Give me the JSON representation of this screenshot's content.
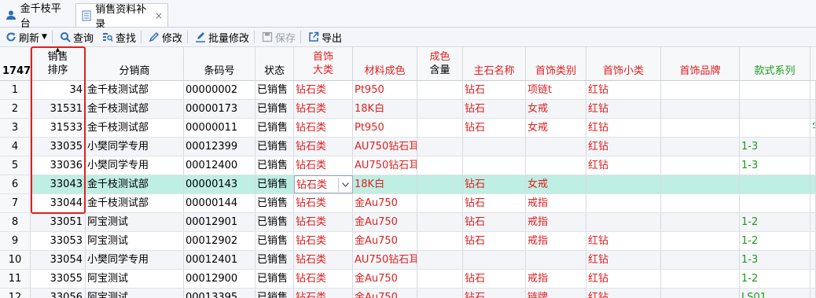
{
  "tabs": [
    {
      "label": "金千枝平台",
      "icon": "avatar-icon"
    },
    {
      "label": "销售资料补录",
      "icon": "document-icon",
      "close": "×"
    }
  ],
  "toolbar": {
    "refresh": "刷新",
    "query": "查询",
    "find": "查找",
    "edit": "修改",
    "batch_edit": "批量修改",
    "save": "保存",
    "export": "导出"
  },
  "grid": {
    "headers": {
      "rownum": "1747",
      "sort_line1": "销售",
      "sort_line2": "排序",
      "distributor": "分销商",
      "barcode": "条码号",
      "status": "状态",
      "cat_line1": "首饰",
      "cat_line2": "大类",
      "material": "材料成色",
      "purity_line1": "成色",
      "purity_line2": "含量",
      "stone": "主石名称",
      "jewelry_type": "首饰类别",
      "jewelry_sub": "首饰小类",
      "brand": "首饰品牌",
      "series": "款式系列"
    },
    "rows": [
      {
        "n": "1",
        "sort": "34",
        "dist": "金千枝测试部",
        "barcode": "00000002",
        "status": "已销售",
        "cat": "钻石类",
        "material": "Pt950",
        "purity": "",
        "stone": "钻石",
        "type": "项链t",
        "sub": "红钻",
        "brand": "",
        "series": "",
        "extra": ""
      },
      {
        "n": "2",
        "sort": "31531",
        "dist": "金千枝测试部",
        "barcode": "00000173",
        "status": "已销售",
        "cat": "钻石类",
        "material": "18K白",
        "purity": "",
        "stone": "钻石",
        "type": "女戒",
        "sub": "红钻",
        "brand": "",
        "series": "",
        "extra": ""
      },
      {
        "n": "3",
        "sort": "31533",
        "dist": "金千枝测试部",
        "barcode": "00000011",
        "status": "已销售",
        "cat": "钻石类",
        "material": "Pt950",
        "purity": "",
        "stone": "钻石",
        "type": "女戒",
        "sub": "红钻",
        "brand": "",
        "series": "",
        "extra": "字"
      },
      {
        "n": "4",
        "sort": "33035",
        "dist": "小樊同学专用",
        "barcode": "00012399",
        "status": "已销售",
        "cat": "钻石类",
        "material": "AU750钻石耳",
        "purity": "",
        "stone": "",
        "type": "",
        "sub": "红钻",
        "brand": "",
        "series": "1-3",
        "extra": ""
      },
      {
        "n": "5",
        "sort": "33036",
        "dist": "小樊同学专用",
        "barcode": "00012400",
        "status": "已销售",
        "cat": "钻石类",
        "material": "AU750钻石耳",
        "purity": "",
        "stone": "",
        "type": "",
        "sub": "红钻",
        "brand": "",
        "series": "1-3",
        "extra": ""
      },
      {
        "n": "6",
        "sort": "33043",
        "dist": "金千枝测试部",
        "barcode": "00000143",
        "status": "已销售",
        "cat": "钻石类",
        "material": "18K白",
        "purity": "",
        "stone": "钻石",
        "type": "女戒",
        "sub": "",
        "brand": "",
        "series": "",
        "extra": ""
      },
      {
        "n": "7",
        "sort": "33044",
        "dist": "金千枝测试部",
        "barcode": "00000144",
        "status": "已销售",
        "cat": "钻石类",
        "material": "金Au750",
        "purity": "",
        "stone": "钻石",
        "type": "戒指",
        "sub": "",
        "brand": "",
        "series": "",
        "extra": ""
      },
      {
        "n": "8",
        "sort": "33051",
        "dist": "阿宝测试",
        "barcode": "00012901",
        "status": "已销售",
        "cat": "钻石类",
        "material": "金Au750",
        "purity": "",
        "stone": "钻石",
        "type": "戒指",
        "sub": "",
        "brand": "",
        "series": "1-2",
        "extra": ""
      },
      {
        "n": "9",
        "sort": "33053",
        "dist": "阿宝测试",
        "barcode": "00012902",
        "status": "已销售",
        "cat": "钻石类",
        "material": "金Au750",
        "purity": "",
        "stone": "钻石",
        "type": "戒指",
        "sub": "红钻",
        "brand": "",
        "series": "1-2",
        "extra": ""
      },
      {
        "n": "10",
        "sort": "33054",
        "dist": "小樊同学专用",
        "barcode": "00012401",
        "status": "已销售",
        "cat": "钻石类",
        "material": "AU750钻石耳",
        "purity": "",
        "stone": "",
        "type": "",
        "sub": "红钻",
        "brand": "",
        "series": "1-3",
        "extra": ""
      },
      {
        "n": "11",
        "sort": "33055",
        "dist": "阿宝测试",
        "barcode": "00012900",
        "status": "已销售",
        "cat": "钻石类",
        "material": "金Au750",
        "purity": "",
        "stone": "钻石",
        "type": "戒指",
        "sub": "红钻",
        "brand": "",
        "series": "1-2",
        "extra": ""
      },
      {
        "n": "12",
        "sort": "33056",
        "dist": "阿宝测试",
        "barcode": "00013395",
        "status": "已销售",
        "cat": "钻石类",
        "material": "金Au750",
        "purity": "",
        "stone": "钻石",
        "type": "链牌",
        "sub": "红钻",
        "brand": "",
        "series": "LS01",
        "extra": ""
      }
    ],
    "selected_row": "6"
  },
  "colors": {
    "accent_red": "#e02020",
    "green": "#1a9b1a",
    "selected": "#bfeee3"
  }
}
